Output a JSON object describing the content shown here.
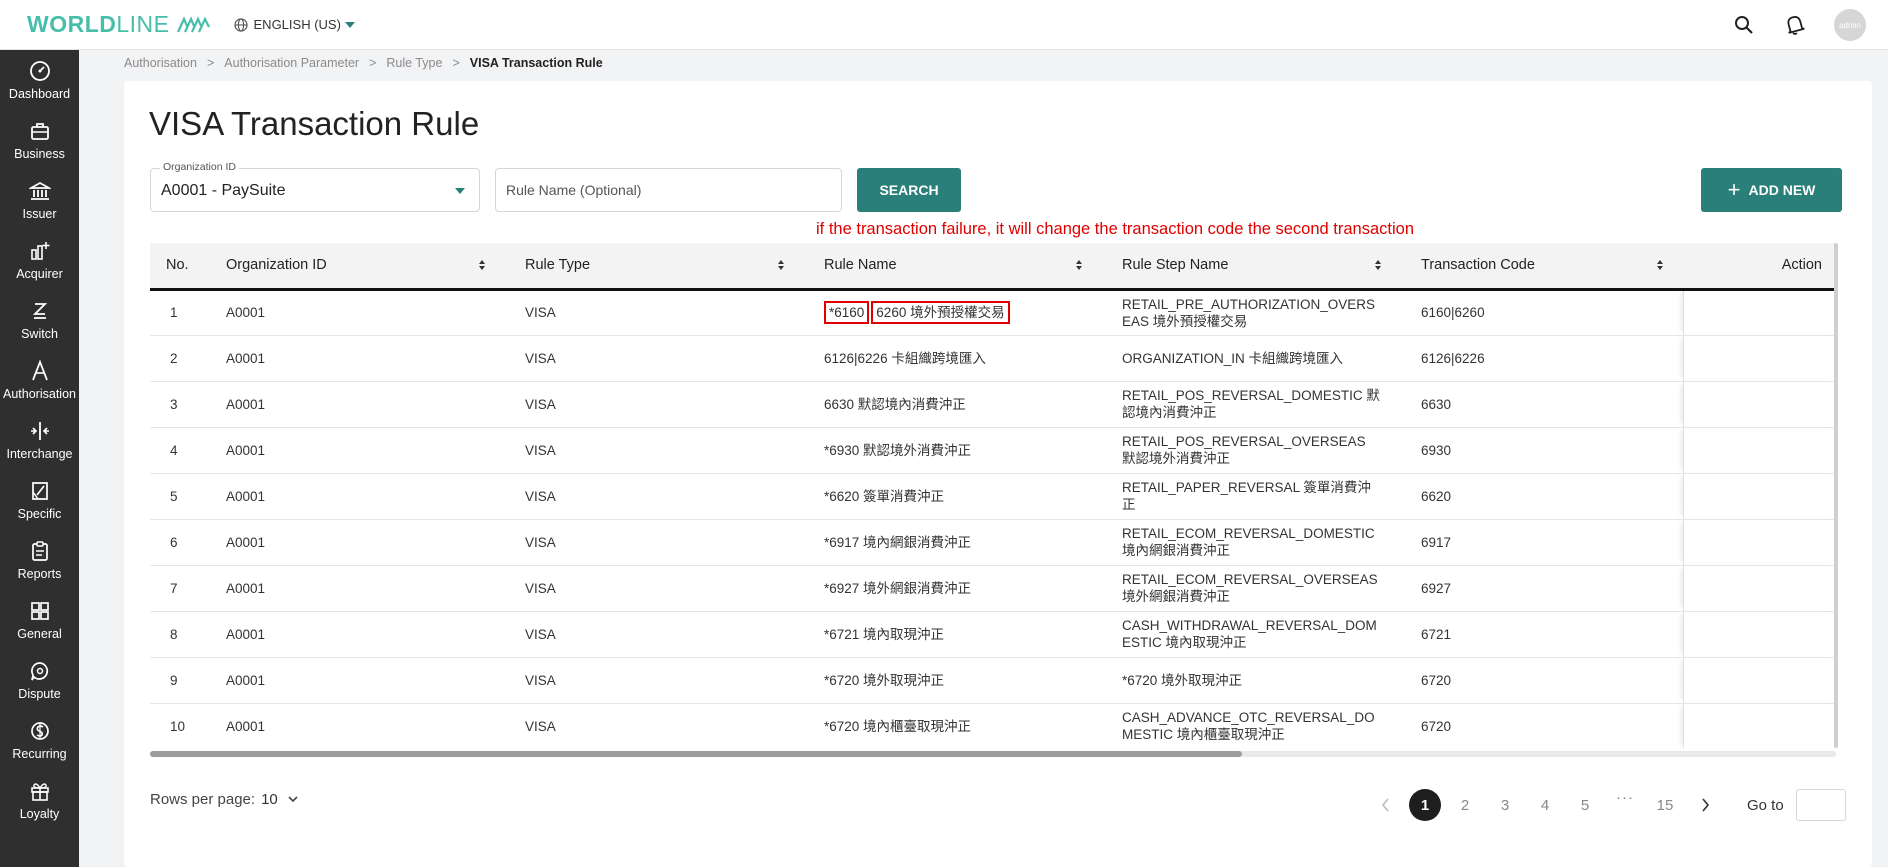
{
  "header": {
    "logo_bold": "WORLD",
    "logo_light": "LINE",
    "language": "ENGLISH (US)",
    "avatar_text": "admin"
  },
  "sidebar": {
    "items": [
      {
        "label": "Dashboard",
        "icon": "dashboard-icon"
      },
      {
        "label": "Business",
        "icon": "briefcase-icon"
      },
      {
        "label": "Issuer",
        "icon": "bank-icon"
      },
      {
        "label": "Acquirer",
        "icon": "acquirer-icon"
      },
      {
        "label": "Switch",
        "icon": "switch-icon"
      },
      {
        "label": "Authorisation",
        "icon": "authorisation-icon"
      },
      {
        "label": "Interchange",
        "icon": "interchange-icon"
      },
      {
        "label": "Specific",
        "icon": "specific-icon"
      },
      {
        "label": "Reports",
        "icon": "clipboard-icon"
      },
      {
        "label": "General",
        "icon": "grid-icon"
      },
      {
        "label": "Dispute",
        "icon": "dispute-icon"
      },
      {
        "label": "Recurring",
        "icon": "recurring-icon"
      },
      {
        "label": "Loyalty",
        "icon": "gift-icon"
      }
    ]
  },
  "breadcrumb": {
    "items": [
      "Authorisation",
      "Authorisation Parameter",
      "Rule Type"
    ],
    "current": "VISA Transaction Rule",
    "separator": ">"
  },
  "page": {
    "title": "VISA Transaction Rule"
  },
  "filters": {
    "org_label": "Organization ID",
    "org_value": "A0001 - PaySuite",
    "rule_placeholder": "Rule Name (Optional)",
    "search_label": "SEARCH",
    "add_label": "ADD NEW"
  },
  "annotation": "if the transaction failure, it will change the transaction code the second transaction",
  "table": {
    "headers": {
      "no": "No.",
      "org": "Organization ID",
      "type": "Rule Type",
      "name": "Rule Name",
      "step": "Rule Step Name",
      "code": "Transaction Code",
      "action": "Action"
    },
    "rows": [
      {
        "no": "1",
        "org": "A0001",
        "type": "VISA",
        "name_a": "*6160",
        "name_b": "6260 境外預授權交易",
        "step": "RETAIL_PRE_AUTHORIZATION_OVERSEAS 境外預授權交易",
        "code": "6160|6260"
      },
      {
        "no": "2",
        "org": "A0001",
        "type": "VISA",
        "name": "6126|6226 卡組織跨境匯入",
        "step": "ORGANIZATION_IN 卡組織跨境匯入",
        "code": "6126|6226"
      },
      {
        "no": "3",
        "org": "A0001",
        "type": "VISA",
        "name": "6630 默認境內消費沖正",
        "step": "RETAIL_POS_REVERSAL_DOMESTIC 默認境內消費沖正",
        "code": "6630"
      },
      {
        "no": "4",
        "org": "A0001",
        "type": "VISA",
        "name": "*6930 默認境外消費沖正",
        "step": "RETAIL_POS_REVERSAL_OVERSEAS 默認境外消費沖正",
        "code": "6930"
      },
      {
        "no": "5",
        "org": "A0001",
        "type": "VISA",
        "name": "*6620 簽單消費沖正",
        "step": "RETAIL_PAPER_REVERSAL 簽單消費沖正",
        "code": "6620"
      },
      {
        "no": "6",
        "org": "A0001",
        "type": "VISA",
        "name": "*6917 境內網銀消費沖正",
        "step": "RETAIL_ECOM_REVERSAL_DOMESTIC 境內網銀消費沖正",
        "code": "6917"
      },
      {
        "no": "7",
        "org": "A0001",
        "type": "VISA",
        "name": "*6927 境外網銀消費沖正",
        "step": "RETAIL_ECOM_REVERSAL_OVERSEAS 境外網銀消費沖正",
        "code": "6927"
      },
      {
        "no": "8",
        "org": "A0001",
        "type": "VISA",
        "name": "*6721 境內取現沖正",
        "step": "CASH_WITHDRAWAL_REVERSAL_DOMESTIC 境內取現沖正",
        "code": "6721"
      },
      {
        "no": "9",
        "org": "A0001",
        "type": "VISA",
        "name": "*6720 境外取現沖正",
        "step": "*6720 境外取現沖正",
        "code": "6720"
      },
      {
        "no": "10",
        "org": "A0001",
        "type": "VISA",
        "name": "*6720 境內櫃臺取現沖正",
        "step": "CASH_ADVANCE_OTC_REVERSAL_DOMESTIC 境內櫃臺取現沖正",
        "code": "6720"
      }
    ]
  },
  "footer": {
    "rows_label": "Rows per page:",
    "rows_value": "10",
    "pages": [
      "1",
      "2",
      "3",
      "4",
      "5"
    ],
    "ellipsis": "···",
    "last_page": "15",
    "current_page": "1",
    "goto_label": "Go to"
  },
  "colors": {
    "brand": "#46beaa",
    "primary_button": "#2a7f7a",
    "sidebar_bg": "#2f2f2f",
    "annotation": "#e00000"
  }
}
